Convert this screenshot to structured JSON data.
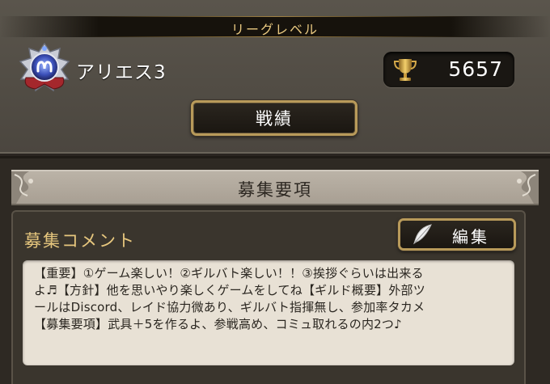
{
  "league": {
    "header_label": "リーグレベル",
    "rank_name": "アリエス3",
    "score": "5657",
    "record_button_label": "戦績",
    "emblem_icon": "aries-emblem-icon",
    "score_icon": "trophy-icon"
  },
  "recruit": {
    "title": "募集要項",
    "comment_label": "募集コメント",
    "edit_button_label": "編集",
    "edit_icon": "quill-icon",
    "comment_lines": [
      "【重要】①ゲーム楽しい！②ギルバト楽しい！！③挨拶ぐらいは出来る",
      "よ♬【方針】他を思いやり楽しくゲームをしてね【ギルド概要】外部ツ",
      "ールはDiscord、レイド協力微あり、ギルバト指揮無し、参加率タカメ",
      "【募集要項】武具＋5を作るよ、参戦高め、コミュ取れるの内2つ♪"
    ]
  },
  "colors": {
    "accent_gold": "#e7c77e",
    "button_border": "#b89a5a",
    "panel_grey": "#4b463f",
    "comment_bg": "#e8e1d5"
  }
}
